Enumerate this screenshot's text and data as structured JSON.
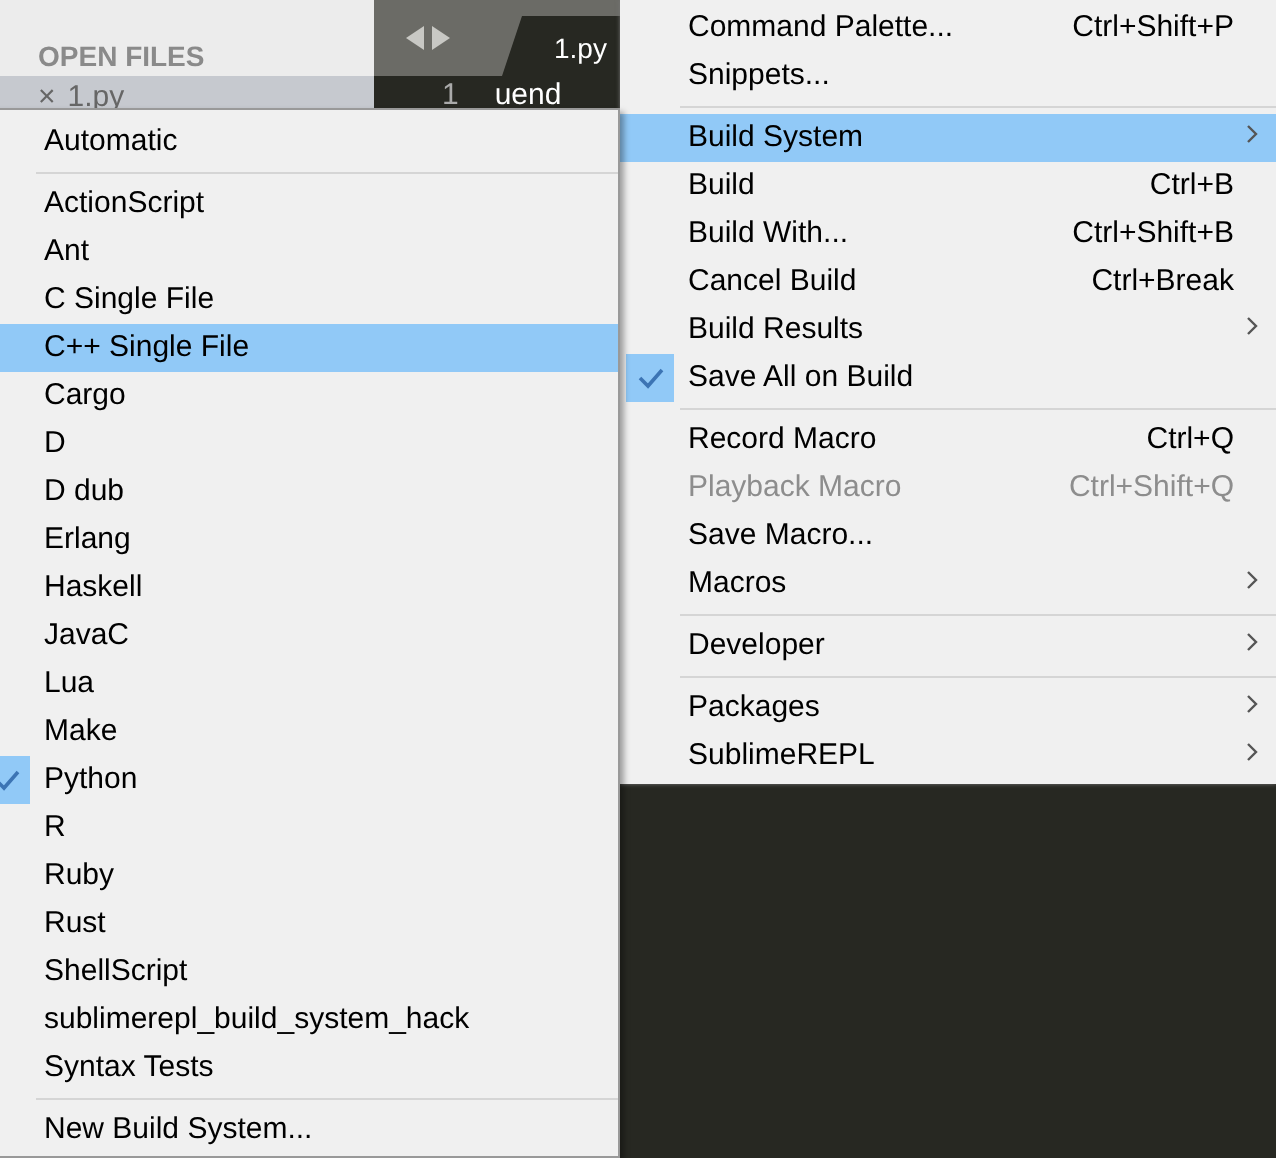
{
  "sidebar": {
    "header": "OPEN FILES",
    "files": [
      {
        "close": "×",
        "name": "1.py",
        "selected": true
      }
    ]
  },
  "editor": {
    "tabs": [
      {
        "label": "1.py",
        "selected": true
      }
    ],
    "line_numbers": [
      "1"
    ],
    "code": "uend"
  },
  "menu": [
    {
      "kind": "item",
      "label": "Command Palette...",
      "shortcut": "Ctrl+Shift+P",
      "has_submenu": false,
      "checked": false,
      "disabled": false,
      "selected": false
    },
    {
      "kind": "item",
      "label": "Snippets...",
      "has_submenu": false,
      "checked": false,
      "disabled": false,
      "selected": false
    },
    {
      "kind": "separator"
    },
    {
      "kind": "item",
      "label": "Build System",
      "has_submenu": true,
      "checked": false,
      "disabled": false,
      "selected": true
    },
    {
      "kind": "item",
      "label": "Build",
      "shortcut": "Ctrl+B",
      "has_submenu": false,
      "checked": false,
      "disabled": false,
      "selected": false
    },
    {
      "kind": "item",
      "label": "Build With...",
      "shortcut": "Ctrl+Shift+B",
      "has_submenu": false,
      "checked": false,
      "disabled": false,
      "selected": false
    },
    {
      "kind": "item",
      "label": "Cancel Build",
      "shortcut": "Ctrl+Break",
      "has_submenu": false,
      "checked": false,
      "disabled": false,
      "selected": false
    },
    {
      "kind": "item",
      "label": "Build Results",
      "has_submenu": true,
      "checked": false,
      "disabled": false,
      "selected": false
    },
    {
      "kind": "item",
      "label": "Save All on Build",
      "has_submenu": false,
      "checked": true,
      "disabled": false,
      "selected": false
    },
    {
      "kind": "separator"
    },
    {
      "kind": "item",
      "label": "Record Macro",
      "shortcut": "Ctrl+Q",
      "has_submenu": false,
      "checked": false,
      "disabled": false,
      "selected": false
    },
    {
      "kind": "item",
      "label": "Playback Macro",
      "shortcut": "Ctrl+Shift+Q",
      "has_submenu": false,
      "checked": false,
      "disabled": true,
      "selected": false
    },
    {
      "kind": "item",
      "label": "Save Macro...",
      "has_submenu": false,
      "checked": false,
      "disabled": false,
      "selected": false
    },
    {
      "kind": "item",
      "label": "Macros",
      "has_submenu": true,
      "checked": false,
      "disabled": false,
      "selected": false
    },
    {
      "kind": "separator"
    },
    {
      "kind": "item",
      "label": "Developer",
      "has_submenu": true,
      "checked": false,
      "disabled": false,
      "selected": false
    },
    {
      "kind": "separator"
    },
    {
      "kind": "item",
      "label": "Packages",
      "has_submenu": true,
      "checked": false,
      "disabled": false,
      "selected": false
    },
    {
      "kind": "item",
      "label": "SublimeREPL",
      "has_submenu": true,
      "checked": false,
      "disabled": false,
      "selected": false
    }
  ],
  "submenu": [
    {
      "kind": "item",
      "label": "Automatic",
      "checked": false,
      "selected": false
    },
    {
      "kind": "separator"
    },
    {
      "kind": "item",
      "label": "ActionScript",
      "checked": false,
      "selected": false
    },
    {
      "kind": "item",
      "label": "Ant",
      "checked": false,
      "selected": false
    },
    {
      "kind": "item",
      "label": "C Single File",
      "checked": false,
      "selected": false
    },
    {
      "kind": "item",
      "label": "C++ Single File",
      "checked": false,
      "selected": true
    },
    {
      "kind": "item",
      "label": "Cargo",
      "checked": false,
      "selected": false
    },
    {
      "kind": "item",
      "label": "D",
      "checked": false,
      "selected": false
    },
    {
      "kind": "item",
      "label": "D dub",
      "checked": false,
      "selected": false
    },
    {
      "kind": "item",
      "label": "Erlang",
      "checked": false,
      "selected": false
    },
    {
      "kind": "item",
      "label": "Haskell",
      "checked": false,
      "selected": false
    },
    {
      "kind": "item",
      "label": "JavaC",
      "checked": false,
      "selected": false
    },
    {
      "kind": "item",
      "label": "Lua",
      "checked": false,
      "selected": false
    },
    {
      "kind": "item",
      "label": "Make",
      "checked": false,
      "selected": false
    },
    {
      "kind": "item",
      "label": "Python",
      "checked": true,
      "selected": false
    },
    {
      "kind": "item",
      "label": "R",
      "checked": false,
      "selected": false
    },
    {
      "kind": "item",
      "label": "Ruby",
      "checked": false,
      "selected": false
    },
    {
      "kind": "item",
      "label": "Rust",
      "checked": false,
      "selected": false
    },
    {
      "kind": "item",
      "label": "ShellScript",
      "checked": false,
      "selected": false
    },
    {
      "kind": "item",
      "label": "sublimerepl_build_system_hack",
      "checked": false,
      "selected": false
    },
    {
      "kind": "item",
      "label": "Syntax Tests",
      "checked": false,
      "selected": false
    },
    {
      "kind": "separator"
    },
    {
      "kind": "item",
      "label": "New Build System...",
      "checked": false,
      "selected": false
    }
  ]
}
